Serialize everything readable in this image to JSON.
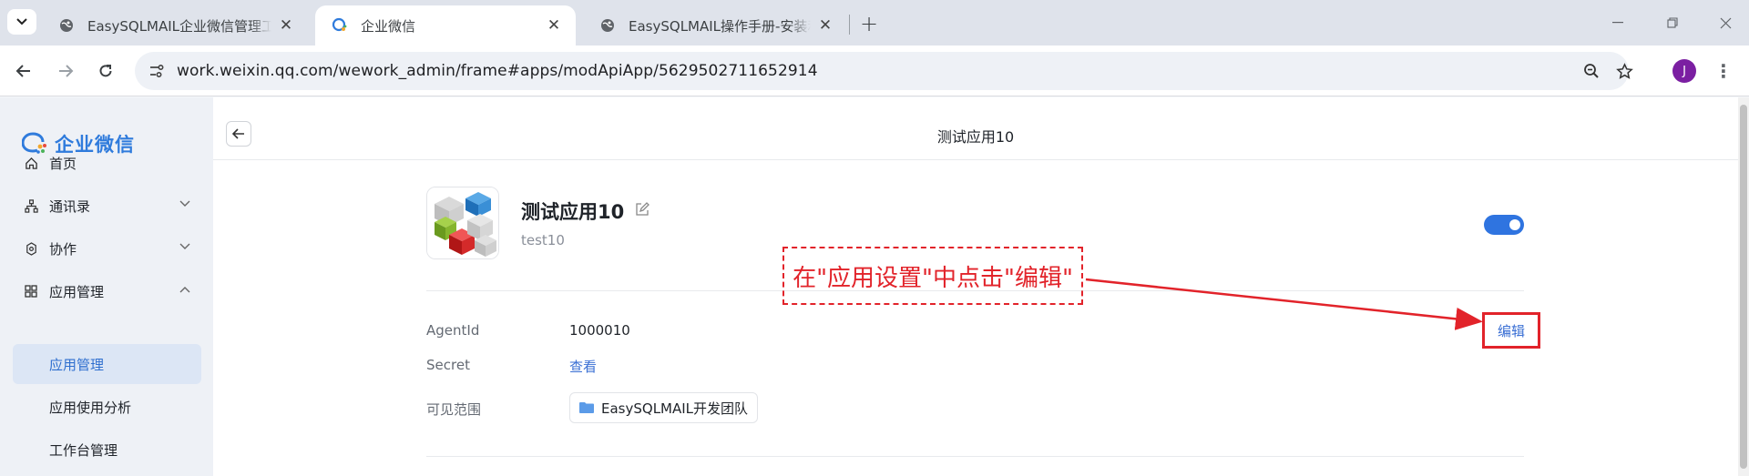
{
  "browser": {
    "tabs": [
      {
        "title": "EasySQLMAIL企业微信管理工具",
        "active": false,
        "icon": "globe-icon"
      },
      {
        "title": "企业微信",
        "active": true,
        "icon": "wecom-logo-icon"
      },
      {
        "title": "EasySQLMAIL操作手册-安装和配置",
        "active": false,
        "icon": "globe-icon"
      }
    ],
    "url": "work.weixin.qq.com/wework_admin/frame#apps/modApiApp/5629502711652914",
    "profile_initial": "J"
  },
  "sidebar": {
    "logo_text": "企业微信",
    "items": [
      {
        "label": "首页",
        "icon": "home-icon"
      },
      {
        "label": "通讯录",
        "icon": "org-chart-icon"
      },
      {
        "label": "协作",
        "icon": "collab-icon"
      },
      {
        "label": "应用管理",
        "icon": "grid-icon"
      },
      {
        "label": "应用管理"
      },
      {
        "label": "应用使用分析"
      },
      {
        "label": "工作台管理"
      }
    ]
  },
  "main": {
    "page_title": "测试应用10",
    "app": {
      "name": "测试应用10",
      "subtitle": "test10",
      "enabled": true
    },
    "fields": {
      "agentid_label": "AgentId",
      "agentid_value": "1000010",
      "secret_label": "Secret",
      "secret_link": "查看",
      "scope_label": "可见范围",
      "scope_value": "EasySQLMAIL开发团队"
    },
    "edit_link": "编辑",
    "callout_text": "在\"应用设置\"中点击\"编辑\""
  },
  "colors": {
    "accent": "#2f74e0",
    "link": "#3a6fd4",
    "annotation_red": "#e2232a",
    "sidebar_bg": "#eef1f6"
  }
}
